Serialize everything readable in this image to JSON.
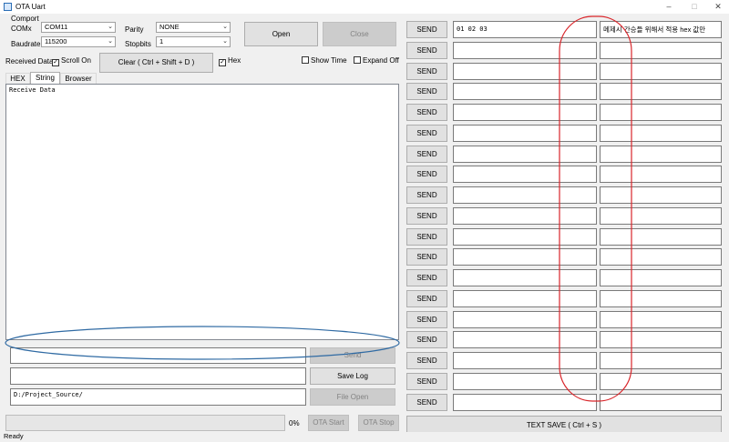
{
  "window": {
    "title": "OTA Uart",
    "min": "–",
    "max": "□",
    "close": "✕"
  },
  "comport": {
    "group_label": "Comport",
    "comx_label": "COMx",
    "comx_value": "COM11",
    "baud_label": "Baudrate",
    "baud_value": "115200",
    "parity_label": "Parity",
    "parity_value": "NONE",
    "stopbits_label": "Stopbits",
    "stopbits_value": "1"
  },
  "buttons": {
    "open": "Open",
    "close": "Close",
    "clear": "Clear ( Ctrl + Shift + D )",
    "send": "Send",
    "save_log": "Save Log",
    "file_open": "File Open",
    "ota_start": "OTA Start",
    "ota_stop": "OTA Stop",
    "text_save": "TEXT SAVE ( Ctrl + S )"
  },
  "options": {
    "received_data": "Received Data",
    "scroll_on": "Scroll On",
    "hex": "Hex",
    "show_time": "Show Time",
    "expand_off": "Expand Off",
    "scroll_on_checked": true,
    "hex_checked": true,
    "show_time_checked": false,
    "expand_off_checked": false
  },
  "tabs": [
    "HEX",
    "String",
    "Browser"
  ],
  "receive": {
    "text": "Receive Data"
  },
  "inputs": {
    "send_value": "",
    "log_value": "",
    "path_value": "D:/Project_Source/"
  },
  "progress": {
    "value": 0,
    "label": "0%"
  },
  "status": "Ready",
  "send_rows": [
    {
      "button": "SEND",
      "hex": "01 02 03",
      "memo": "메제시 간승들 위해서 적용 hex 값만"
    },
    {
      "button": "SEND",
      "hex": "",
      "memo": ""
    },
    {
      "button": "SEND",
      "hex": "",
      "memo": ""
    },
    {
      "button": "SEND",
      "hex": "",
      "memo": ""
    },
    {
      "button": "SEND",
      "hex": "",
      "memo": ""
    },
    {
      "button": "SEND",
      "hex": "",
      "memo": ""
    },
    {
      "button": "SEND",
      "hex": "",
      "memo": ""
    },
    {
      "button": "SEND",
      "hex": "",
      "memo": ""
    },
    {
      "button": "SEND",
      "hex": "",
      "memo": ""
    },
    {
      "button": "SEND",
      "hex": "",
      "memo": ""
    },
    {
      "button": "SEND",
      "hex": "",
      "memo": ""
    },
    {
      "button": "SEND",
      "hex": "",
      "memo": ""
    },
    {
      "button": "SEND",
      "hex": "",
      "memo": ""
    },
    {
      "button": "SEND",
      "hex": "",
      "memo": ""
    },
    {
      "button": "SEND",
      "hex": "",
      "memo": ""
    },
    {
      "button": "SEND",
      "hex": "",
      "memo": ""
    },
    {
      "button": "SEND",
      "hex": "",
      "memo": ""
    },
    {
      "button": "SEND",
      "hex": "",
      "memo": ""
    },
    {
      "button": "SEND",
      "hex": "",
      "memo": ""
    }
  ],
  "annotations": {
    "ellipse_red": "#d9262b",
    "ellipse_blue": "#2f6aa3"
  }
}
